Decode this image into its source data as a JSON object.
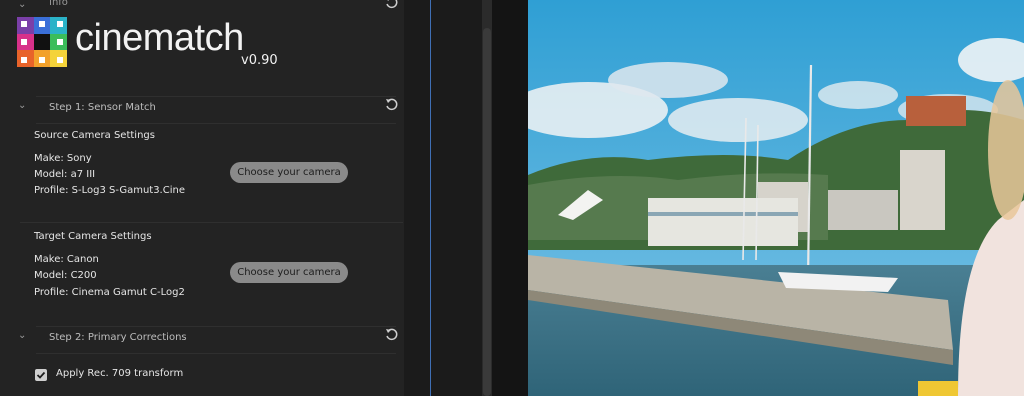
{
  "panel": {
    "info_label": "Info",
    "logo_text_light": "cine",
    "logo_text_bold": "match",
    "version": "v0.90",
    "step1_title": "Step 1: Sensor Match",
    "source": {
      "heading": "Source Camera Settings",
      "make": "Make:   Sony",
      "model": "Model:  a7 III",
      "profile": "Profile:  S-Log3 S-Gamut3.Cine",
      "button": "Choose your camera"
    },
    "target": {
      "heading": "Target Camera Settings",
      "make": "Make:   Canon",
      "model": "Model:  C200",
      "profile": "Profile:  Cinema Gamut C-Log2",
      "button": "Choose your camera"
    },
    "step2_title": "Step 2: Primary Corrections",
    "apply_rec709": "Apply Rec. 709 transform",
    "apply_rec709_checked": true
  },
  "colors": {
    "panel_bg": "#232323",
    "button_bg": "#8a8a8a",
    "accent_line": "#3f6fb5"
  }
}
